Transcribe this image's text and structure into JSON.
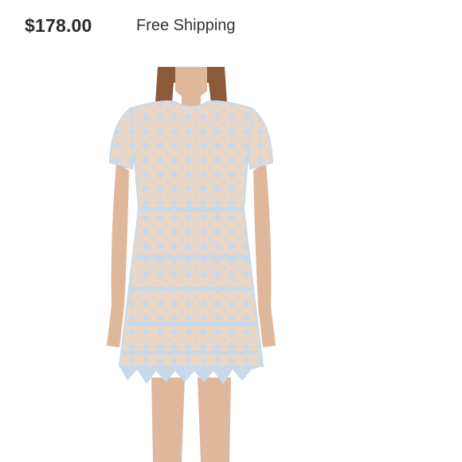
{
  "listing": {
    "price": "$178.00",
    "shipping": "Free Shipping"
  },
  "photo": {
    "icon": "dress-photo",
    "colors": {
      "lace": "#c9d9ea",
      "lining": "#ead7c6",
      "skin": "#dfb79a",
      "hair": "#8a5a3a"
    }
  }
}
